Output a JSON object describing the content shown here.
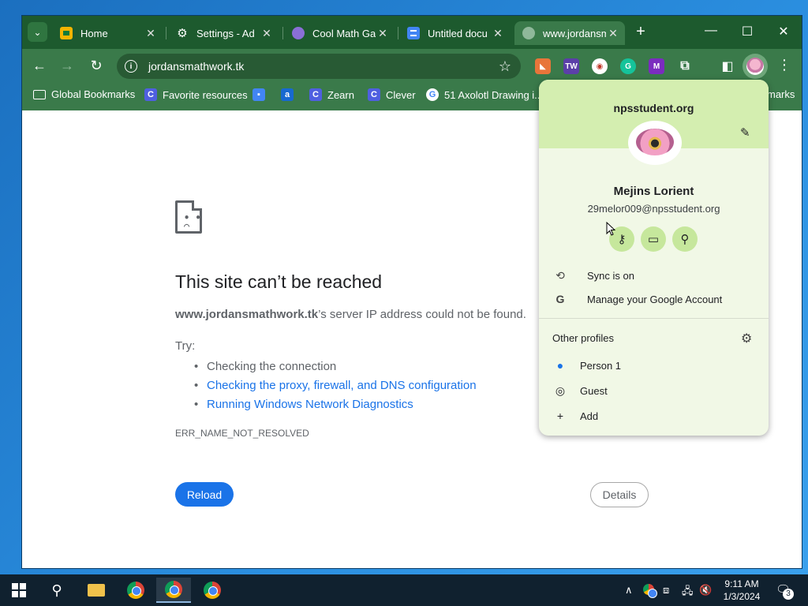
{
  "tabs": [
    {
      "label": "Home",
      "icon": "classroom-icon",
      "active": false
    },
    {
      "label": "Settings - Ad",
      "icon": "gear-icon",
      "active": false
    },
    {
      "label": "Cool Math Ga",
      "icon": "coolmath-icon",
      "active": false
    },
    {
      "label": "Untitled docu",
      "icon": "docs-icon",
      "active": false
    },
    {
      "label": "www.jordansm",
      "icon": "globe-icon",
      "active": true
    }
  ],
  "toolbar": {
    "url": "jordansmathwork.tk"
  },
  "bookmarks": [
    {
      "label": "Global Bookmarks",
      "icon": "folder-icon"
    },
    {
      "label": "Favorite resources",
      "icon": "clever-icon"
    },
    {
      "label": "",
      "icon": "portrait-icon"
    },
    {
      "label": "",
      "icon": "aa-icon"
    },
    {
      "label": "Zearn",
      "icon": "clever-icon"
    },
    {
      "label": "Clever",
      "icon": "clever-icon"
    },
    {
      "label": "51 Axolotl Drawing i...",
      "icon": "google-icon"
    },
    {
      "label": "marks",
      "icon": ""
    }
  ],
  "error_page": {
    "title": "This site can’t be reached",
    "domain": "www.jordansmathwork.tk",
    "desc_suffix": "’s server IP address could not be found.",
    "try_label": "Try:",
    "suggestions": [
      "Checking the connection",
      "Checking the proxy, firewall, and DNS configuration",
      "Running Windows Network Diagnostics"
    ],
    "error_code": "ERR_NAME_NOT_RESOLVED",
    "reload_label": "Reload",
    "details_label": "Details"
  },
  "profile_menu": {
    "org": "npsstudent.org",
    "name": "Mejins Lorient",
    "email": "29melor009@npsstudent.org",
    "sync": "Sync is on",
    "manage": "Manage your Google Account",
    "other_title": "Other profiles",
    "profiles": [
      "Person 1",
      "Guest",
      "Add"
    ]
  },
  "taskbar": {
    "time": "9:11 AM",
    "date": "1/3/2024",
    "notification_count": "3"
  },
  "colors": {
    "accent": "#1a73e8",
    "frame": "#1d5a2e",
    "toolbar": "#3a7a4a",
    "popup_head": "#d4eeb0"
  }
}
